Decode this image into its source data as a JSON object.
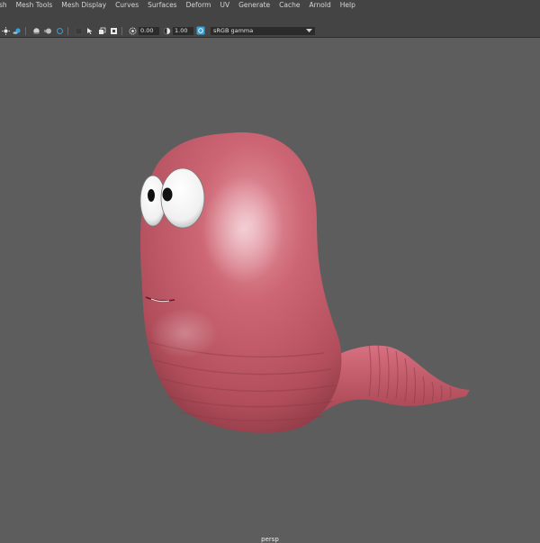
{
  "menubar": {
    "items": [
      "sh",
      "Mesh Tools",
      "Mesh Display",
      "Curves",
      "Surfaces",
      "Deform",
      "UV",
      "Generate",
      "Cache",
      "Arnold",
      "Help"
    ]
  },
  "toolbar": {
    "exposure_value": "0.00",
    "gamma_value": "1.00",
    "color_space": "sRGB gamma"
  },
  "viewport": {
    "camera_label": "persp",
    "model": "cartoon-worm",
    "colors": {
      "background": "#5d5d5d",
      "worm_body": "#c45a68"
    }
  }
}
